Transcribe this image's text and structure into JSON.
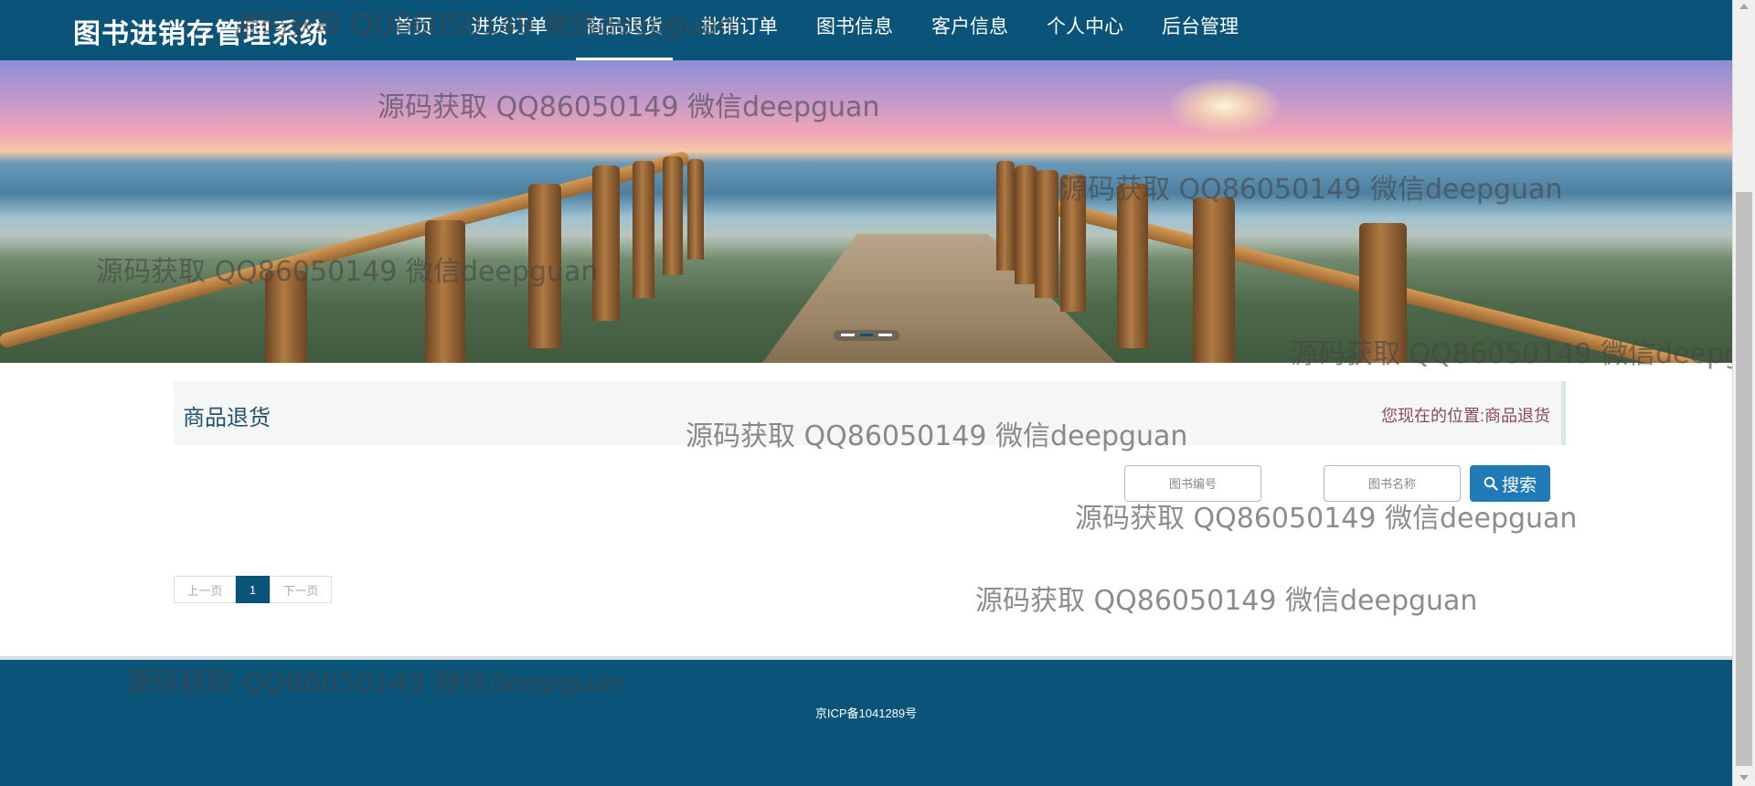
{
  "navbar": {
    "brand": "图书进销存管理系统",
    "items": [
      {
        "label": "首页"
      },
      {
        "label": "进货订单"
      },
      {
        "label": "商品退货"
      },
      {
        "label": "批销订单"
      },
      {
        "label": "图书信息"
      },
      {
        "label": "客户信息"
      },
      {
        "label": "个人中心"
      },
      {
        "label": "后台管理"
      }
    ],
    "active": "商品退货"
  },
  "page_header": {
    "title": "商品退货",
    "location_label": "您现在的位置:",
    "location_current": "商品退货"
  },
  "search": {
    "book_code_placeholder": "图书编号",
    "book_name_placeholder": "图书名称",
    "button_label": "搜索"
  },
  "pagination": {
    "prev_label": "上一页",
    "current_page": "1",
    "next_label": "下一页"
  },
  "footer": {
    "icp": "京ICP备1041289号"
  },
  "watermark": "源码获取 QQ86050149 微信deepguan",
  "colors": {
    "primary": "#0b5479",
    "search_button": "#1f7ab5",
    "breadcrumb_text": "#8a4a55"
  }
}
